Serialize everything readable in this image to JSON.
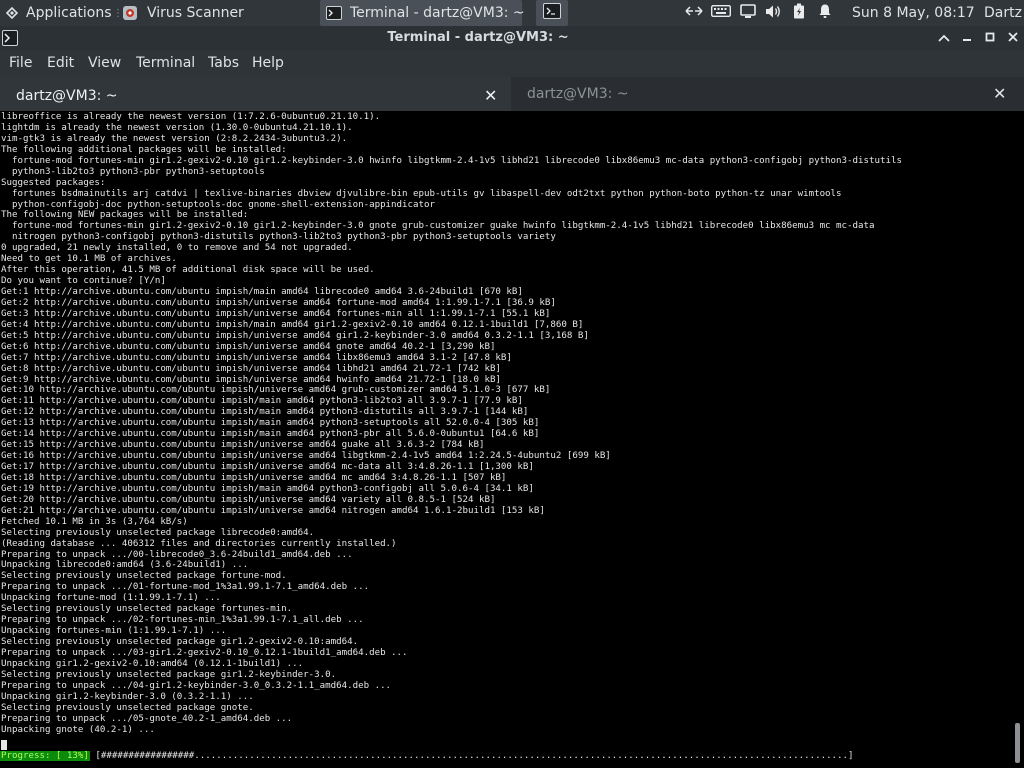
{
  "panel": {
    "applications_label": "Applications",
    "virus_scanner_label": "Virus Scanner",
    "terminal_task_label": "Terminal - dartz@VM3: ~",
    "clock": "Sun  8 May, 08:17",
    "user": "Dartz"
  },
  "window": {
    "title": "Terminal - dartz@VM3: ~"
  },
  "menu": {
    "file": "File",
    "edit": "Edit",
    "view": "View",
    "terminal": "Terminal",
    "tabs": "Tabs",
    "help": "Help"
  },
  "tabs": [
    {
      "label": "dartz@VM3: ~",
      "active": true
    },
    {
      "label": "dartz@VM3: ~",
      "active": false
    }
  ],
  "terminal": {
    "lines": [
      "libreoffice is already the newest version (1:7.2.6-0ubuntu0.21.10.1).",
      "lightdm is already the newest version (1.30.0-0ubuntu4.21.10.1).",
      "vim-gtk3 is already the newest version (2:8.2.2434-3ubuntu3.2).",
      "The following additional packages will be installed:",
      "  fortune-mod fortunes-min gir1.2-gexiv2-0.10 gir1.2-keybinder-3.0 hwinfo libgtkmm-2.4-1v5 libhd21 librecode0 libx86emu3 mc-data python3-configobj python3-distutils",
      "  python3-lib2to3 python3-pbr python3-setuptools",
      "Suggested packages:",
      "  fortunes bsdmainutils arj catdvi | texlive-binaries dbview djvulibre-bin epub-utils gv libaspell-dev odt2txt python python-boto python-tz unar wimtools",
      "  python-configobj-doc python-setuptools-doc gnome-shell-extension-appindicator",
      "The following NEW packages will be installed:",
      "  fortune-mod fortunes-min gir1.2-gexiv2-0.10 gir1.2-keybinder-3.0 gnote grub-customizer guake hwinfo libgtkmm-2.4-1v5 libhd21 librecode0 libx86emu3 mc mc-data",
      "  nitrogen python3-configobj python3-distutils python3-lib2to3 python3-pbr python3-setuptools variety",
      "0 upgraded, 21 newly installed, 0 to remove and 54 not upgraded.",
      "Need to get 10.1 MB of archives.",
      "After this operation, 41.5 MB of additional disk space will be used.",
      "Do you want to continue? [Y/n]",
      "Get:1 http://archive.ubuntu.com/ubuntu impish/main amd64 librecode0 amd64 3.6-24build1 [670 kB]",
      "Get:2 http://archive.ubuntu.com/ubuntu impish/universe amd64 fortune-mod amd64 1:1.99.1-7.1 [36.9 kB]",
      "Get:3 http://archive.ubuntu.com/ubuntu impish/universe amd64 fortunes-min all 1:1.99.1-7.1 [55.1 kB]",
      "Get:4 http://archive.ubuntu.com/ubuntu impish/main amd64 gir1.2-gexiv2-0.10 amd64 0.12.1-1build1 [7,860 B]",
      "Get:5 http://archive.ubuntu.com/ubuntu impish/universe amd64 gir1.2-keybinder-3.0 amd64 0.3.2-1.1 [3,168 B]",
      "Get:6 http://archive.ubuntu.com/ubuntu impish/universe amd64 gnote amd64 40.2-1 [3,290 kB]",
      "Get:7 http://archive.ubuntu.com/ubuntu impish/universe amd64 libx86emu3 amd64 3.1-2 [47.8 kB]",
      "Get:8 http://archive.ubuntu.com/ubuntu impish/universe amd64 libhd21 amd64 21.72-1 [742 kB]",
      "Get:9 http://archive.ubuntu.com/ubuntu impish/universe amd64 hwinfo amd64 21.72-1 [18.0 kB]",
      "Get:10 http://archive.ubuntu.com/ubuntu impish/universe amd64 grub-customizer amd64 5.1.0-3 [677 kB]",
      "Get:11 http://archive.ubuntu.com/ubuntu impish/main amd64 python3-lib2to3 all 3.9.7-1 [77.9 kB]",
      "Get:12 http://archive.ubuntu.com/ubuntu impish/main amd64 python3-distutils all 3.9.7-1 [144 kB]",
      "Get:13 http://archive.ubuntu.com/ubuntu impish/main amd64 python3-setuptools all 52.0.0-4 [305 kB]",
      "Get:14 http://archive.ubuntu.com/ubuntu impish/main amd64 python3-pbr all 5.6.0-0ubuntu1 [64.6 kB]",
      "Get:15 http://archive.ubuntu.com/ubuntu impish/universe amd64 guake all 3.6.3-2 [784 kB]",
      "Get:16 http://archive.ubuntu.com/ubuntu impish/universe amd64 libgtkmm-2.4-1v5 amd64 1:2.24.5-4ubuntu2 [699 kB]",
      "Get:17 http://archive.ubuntu.com/ubuntu impish/universe amd64 mc-data all 3:4.8.26-1.1 [1,300 kB]",
      "Get:18 http://archive.ubuntu.com/ubuntu impish/universe amd64 mc amd64 3:4.8.26-1.1 [507 kB]",
      "Get:19 http://archive.ubuntu.com/ubuntu impish/main amd64 python3-configobj all 5.0.6-4 [34.1 kB]",
      "Get:20 http://archive.ubuntu.com/ubuntu impish/universe amd64 variety all 0.8.5-1 [524 kB]",
      "Get:21 http://archive.ubuntu.com/ubuntu impish/universe amd64 nitrogen amd64 1.6.1-2build1 [153 kB]",
      "Fetched 10.1 MB in 3s (3,764 kB/s)",
      "Selecting previously unselected package librecode0:amd64.",
      "(Reading database ... 406312 files and directories currently installed.)",
      "Preparing to unpack .../00-librecode0_3.6-24build1_amd64.deb ...",
      "Unpacking librecode0:amd64 (3.6-24build1) ...",
      "Selecting previously unselected package fortune-mod.",
      "Preparing to unpack .../01-fortune-mod_1%3a1.99.1-7.1_amd64.deb ...",
      "Unpacking fortune-mod (1:1.99.1-7.1) ...",
      "Selecting previously unselected package fortunes-min.",
      "Preparing to unpack .../02-fortunes-min_1%3a1.99.1-7.1_all.deb ...",
      "Unpacking fortunes-min (1:1.99.1-7.1) ...",
      "Selecting previously unselected package gir1.2-gexiv2-0.10:amd64.",
      "Preparing to unpack .../03-gir1.2-gexiv2-0.10_0.12.1-1build1_amd64.deb ...",
      "Unpacking gir1.2-gexiv2-0.10:amd64 (0.12.1-1build1) ...",
      "Selecting previously unselected package gir1.2-keybinder-3.0.",
      "Preparing to unpack .../04-gir1.2-keybinder-3.0_0.3.2-1.1_amd64.deb ...",
      "Unpacking gir1.2-keybinder-3.0 (0.3.2-1.1) ...",
      "Selecting previously unselected package gnote.",
      "Preparing to unpack .../05-gnote_40.2-1_amd64.deb ...",
      "Unpacking gnote (40.2-1) ..."
    ],
    "progress_label": "Progress: [ 13%]",
    "progress_percent": 13,
    "progress_bar": " [#################.......................................................................................................................]"
  },
  "colors": {
    "panel_bg": "#31363b",
    "terminal_bg": "#000000",
    "terminal_fg": "#e6e6e6",
    "progress_bg": "#0b8a0b"
  }
}
